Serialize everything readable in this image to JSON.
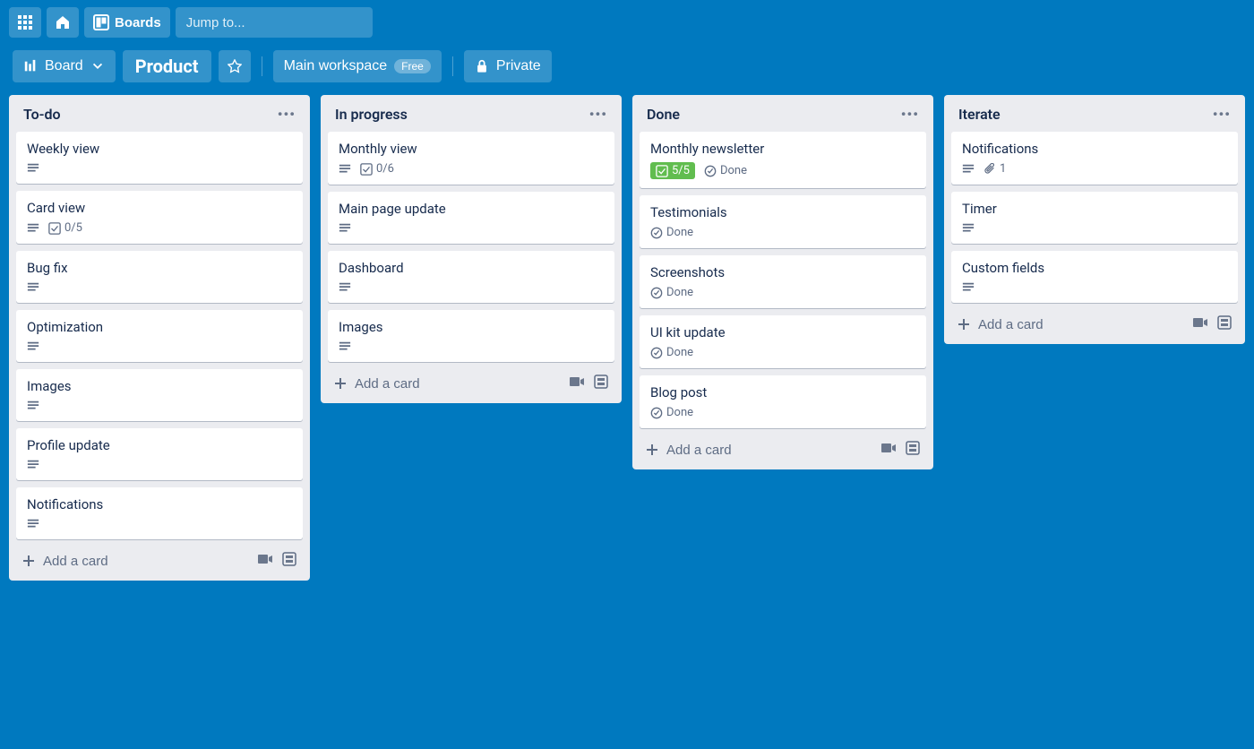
{
  "nav": {
    "boards_label": "Boards",
    "search_placeholder": "Jump to..."
  },
  "board_header": {
    "view_label": "Board",
    "title": "Product",
    "workspace": "Main workspace",
    "workspace_tag": "Free",
    "visibility": "Private"
  },
  "add_card_label": "Add a card",
  "lists": [
    {
      "title": "To-do",
      "cards": [
        {
          "title": "Weekly view",
          "badges": [
            {
              "type": "desc"
            }
          ]
        },
        {
          "title": "Card view",
          "badges": [
            {
              "type": "desc"
            },
            {
              "type": "checklist",
              "text": "0/5"
            }
          ]
        },
        {
          "title": "Bug fix",
          "badges": [
            {
              "type": "desc"
            }
          ]
        },
        {
          "title": "Optimization",
          "badges": [
            {
              "type": "desc"
            }
          ]
        },
        {
          "title": "Images",
          "badges": [
            {
              "type": "desc"
            }
          ]
        },
        {
          "title": "Profile update",
          "badges": [
            {
              "type": "desc"
            }
          ]
        },
        {
          "title": "Notifications",
          "badges": [
            {
              "type": "desc"
            }
          ]
        }
      ]
    },
    {
      "title": "In progress",
      "cards": [
        {
          "title": "Monthly view",
          "badges": [
            {
              "type": "desc"
            },
            {
              "type": "checklist",
              "text": "0/6"
            }
          ]
        },
        {
          "title": "Main page update",
          "badges": [
            {
              "type": "desc"
            }
          ]
        },
        {
          "title": "Dashboard",
          "badges": [
            {
              "type": "desc"
            }
          ]
        },
        {
          "title": "Images",
          "badges": [
            {
              "type": "desc"
            }
          ]
        }
      ]
    },
    {
      "title": "Done",
      "cards": [
        {
          "title": "Monthly newsletter",
          "badges": [
            {
              "type": "checklist",
              "text": "5/5",
              "complete": true
            },
            {
              "type": "done",
              "text": "Done"
            }
          ]
        },
        {
          "title": "Testimonials",
          "badges": [
            {
              "type": "done",
              "text": "Done"
            }
          ]
        },
        {
          "title": "Screenshots",
          "badges": [
            {
              "type": "done",
              "text": "Done"
            }
          ]
        },
        {
          "title": "UI kit update",
          "badges": [
            {
              "type": "done",
              "text": "Done"
            }
          ]
        },
        {
          "title": "Blog post",
          "badges": [
            {
              "type": "done",
              "text": "Done"
            }
          ]
        }
      ]
    },
    {
      "title": "Iterate",
      "cards": [
        {
          "title": "Notifications",
          "badges": [
            {
              "type": "desc"
            },
            {
              "type": "attach",
              "text": "1"
            }
          ]
        },
        {
          "title": "Timer",
          "badges": [
            {
              "type": "desc"
            }
          ]
        },
        {
          "title": "Custom fields",
          "badges": [
            {
              "type": "desc"
            }
          ]
        }
      ]
    }
  ]
}
